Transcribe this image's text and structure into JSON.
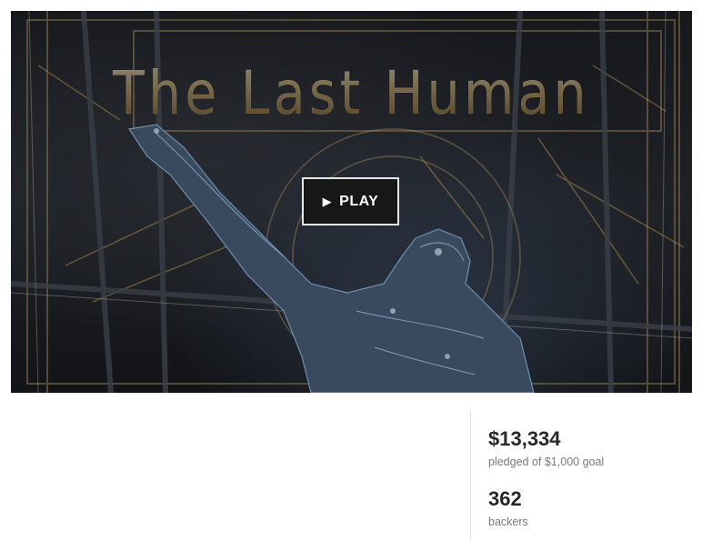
{
  "hero": {
    "title": "The Last Human",
    "play_label": "PLAY",
    "play_icon": "play-icon"
  },
  "stats": {
    "pledged_amount": "$13,334",
    "pledged_caption": "pledged of $1,000 goal",
    "backers_count": "362",
    "backers_caption": "backers"
  },
  "colors": {
    "title_gold": "#cdb78a",
    "text_dark": "#282828",
    "text_muted": "#7a7a7a",
    "divider": "#e3e3e3"
  }
}
